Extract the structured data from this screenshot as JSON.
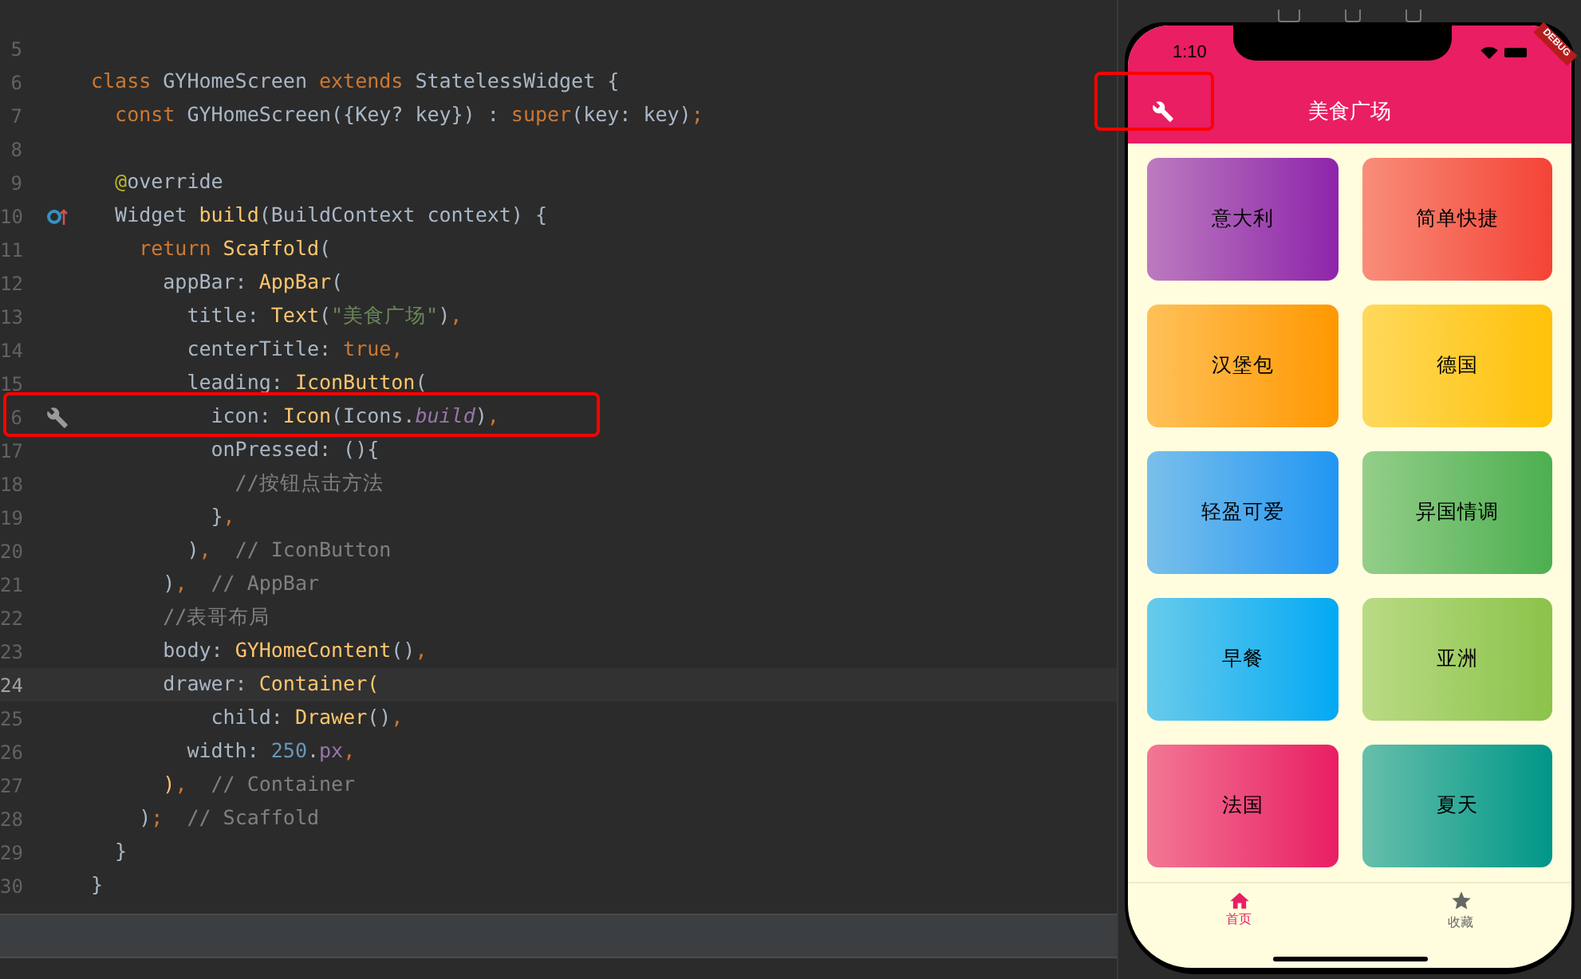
{
  "editor": {
    "lines": [
      {
        "number": "5",
        "current": false
      },
      {
        "number": "6",
        "current": false,
        "tokens": [
          {
            "kind": "keyword",
            "text": "class "
          },
          {
            "kind": "plain",
            "text": "GYHomeScreen "
          },
          {
            "kind": "keyword",
            "text": "extends "
          },
          {
            "kind": "plain",
            "text": "StatelessWidget {"
          }
        ]
      },
      {
        "number": "7",
        "current": false,
        "tokens": [
          {
            "kind": "keyword",
            "text": "  const "
          },
          {
            "kind": "plain",
            "text": "GYHomeScreen({Key? key}) : "
          },
          {
            "kind": "keyword",
            "text": "super"
          },
          {
            "kind": "plain",
            "text": "(key: key)"
          },
          {
            "kind": "keyword",
            "text": ";"
          }
        ]
      },
      {
        "number": "8",
        "current": false
      },
      {
        "number": "9",
        "current": false,
        "tokens": [
          {
            "kind": "annotation",
            "text": "  @"
          },
          {
            "kind": "plain",
            "text": "override"
          }
        ]
      },
      {
        "number": "10",
        "current": false,
        "kind": "override",
        "tokens": [
          {
            "kind": "plain",
            "text": "  Widget "
          },
          {
            "kind": "function",
            "text": "build"
          },
          {
            "kind": "plain",
            "text": "(BuildContext context) {"
          }
        ]
      },
      {
        "number": "11",
        "current": false,
        "tokens": [
          {
            "kind": "keyword",
            "text": "    return "
          },
          {
            "kind": "function",
            "text": "Scaffold"
          },
          {
            "kind": "plain",
            "text": "("
          }
        ]
      },
      {
        "number": "12",
        "current": false,
        "tokens": [
          {
            "kind": "plain",
            "text": "      appBar: "
          },
          {
            "kind": "function",
            "text": "AppBar"
          },
          {
            "kind": "plain",
            "text": "("
          }
        ]
      },
      {
        "number": "13",
        "current": false,
        "tokens": [
          {
            "kind": "plain",
            "text": "        title: "
          },
          {
            "kind": "function",
            "text": "Text"
          },
          {
            "kind": "plain",
            "text": "("
          },
          {
            "kind": "string",
            "text": "\"美食广场\""
          },
          {
            "kind": "plain",
            "text": ")"
          },
          {
            "kind": "keyword",
            "text": ","
          }
        ]
      },
      {
        "number": "14",
        "current": false,
        "tokens": [
          {
            "kind": "plain",
            "text": "        centerTitle: "
          },
          {
            "kind": "keyword",
            "text": "true,"
          }
        ]
      },
      {
        "number": "15",
        "current": false,
        "tokens": [
          {
            "kind": "plain",
            "text": "        leading: "
          },
          {
            "kind": "function",
            "text": "IconButton"
          },
          {
            "kind": "plain",
            "text": "("
          }
        ]
      },
      {
        "number": "6",
        "current": false,
        "kind": "wrench",
        "tokens": [
          {
            "kind": "plain",
            "text": "          icon: "
          },
          {
            "kind": "function",
            "text": "Icon"
          },
          {
            "kind": "plain",
            "text": "(Icons."
          },
          {
            "kind": "field",
            "text": "build"
          },
          {
            "kind": "plain",
            "text": ")"
          },
          {
            "kind": "keyword",
            "text": ","
          }
        ]
      },
      {
        "number": "17",
        "current": false,
        "tokens": [
          {
            "kind": "plain",
            "text": "          onPressed: (){"
          }
        ]
      },
      {
        "number": "18",
        "current": false,
        "tokens": [
          {
            "kind": "comment",
            "text": "            //按钮点击方法"
          }
        ]
      },
      {
        "number": "19",
        "current": false,
        "tokens": [
          {
            "kind": "plain",
            "text": "          }"
          },
          {
            "kind": "keyword",
            "text": ","
          }
        ]
      },
      {
        "number": "20",
        "current": false,
        "tokens": [
          {
            "kind": "plain",
            "text": "        )"
          },
          {
            "kind": "keyword",
            "text": ","
          },
          {
            "kind": "comment",
            "text": "  // IconButton"
          }
        ]
      },
      {
        "number": "21",
        "current": false,
        "tokens": [
          {
            "kind": "plain",
            "text": "      )"
          },
          {
            "kind": "keyword",
            "text": ","
          },
          {
            "kind": "comment",
            "text": "  // AppBar"
          }
        ]
      },
      {
        "number": "22",
        "current": false,
        "tokens": [
          {
            "kind": "comment",
            "text": "      //表哥布局"
          }
        ]
      },
      {
        "number": "23",
        "current": false,
        "tokens": [
          {
            "kind": "plain",
            "text": "      body: "
          },
          {
            "kind": "function",
            "text": "GYHomeContent"
          },
          {
            "kind": "plain",
            "text": "()"
          },
          {
            "kind": "keyword",
            "text": ","
          }
        ]
      },
      {
        "number": "24",
        "current": true,
        "tokens": [
          {
            "kind": "plain",
            "text": "      drawer: "
          },
          {
            "kind": "function",
            "text": "Container("
          }
        ]
      },
      {
        "number": "25",
        "current": false,
        "tokens": [
          {
            "kind": "plain",
            "text": "          child: "
          },
          {
            "kind": "function",
            "text": "Drawer"
          },
          {
            "kind": "plain",
            "text": "()"
          },
          {
            "kind": "keyword",
            "text": ","
          }
        ]
      },
      {
        "number": "26",
        "current": false,
        "tokens": [
          {
            "kind": "plain",
            "text": "        width: "
          },
          {
            "kind": "number",
            "text": "250"
          },
          {
            "kind": "plain",
            "text": "."
          },
          {
            "kind": "property",
            "text": "px"
          },
          {
            "kind": "keyword",
            "text": ","
          }
        ]
      },
      {
        "number": "27",
        "current": false,
        "tokens": [
          {
            "kind": "function",
            "text": "      )"
          },
          {
            "kind": "keyword",
            "text": ","
          },
          {
            "kind": "comment",
            "text": "  // Container"
          }
        ]
      },
      {
        "number": "28",
        "current": false,
        "tokens": [
          {
            "kind": "plain",
            "text": "    )"
          },
          {
            "kind": "keyword",
            "text": ";"
          },
          {
            "kind": "comment",
            "text": "  // Scaffold"
          }
        ]
      },
      {
        "number": "29",
        "current": false,
        "tokens": [
          {
            "kind": "plain",
            "text": "  }"
          }
        ]
      },
      {
        "number": "30",
        "current": false,
        "tokens": [
          {
            "kind": "plain",
            "text": "}"
          }
        ]
      }
    ]
  },
  "phone": {
    "status_time": "1:10",
    "debug_banner": "DEBUG",
    "app_bar": {
      "title": "美食广场"
    },
    "categories": [
      {
        "label": "意大利",
        "color": "#8e24aa"
      },
      {
        "label": "简单快捷",
        "color": "#f44336"
      },
      {
        "label": "汉堡包",
        "color": "#ff9800"
      },
      {
        "label": "德国",
        "color": "#ffc107"
      },
      {
        "label": "轻盈可爱",
        "color": "#2196f3"
      },
      {
        "label": "异国情调",
        "color": "#4caf50"
      },
      {
        "label": "早餐",
        "color": "#03a9f4"
      },
      {
        "label": "亚洲",
        "color": "#8bc34a"
      },
      {
        "label": "法国",
        "color": "#e91e63"
      },
      {
        "label": "夏天",
        "color": "#009688"
      }
    ],
    "bottom_nav": [
      {
        "label": "首页",
        "kind": "home",
        "selected": true
      },
      {
        "label": "收藏",
        "kind": "star",
        "selected": false
      }
    ]
  }
}
